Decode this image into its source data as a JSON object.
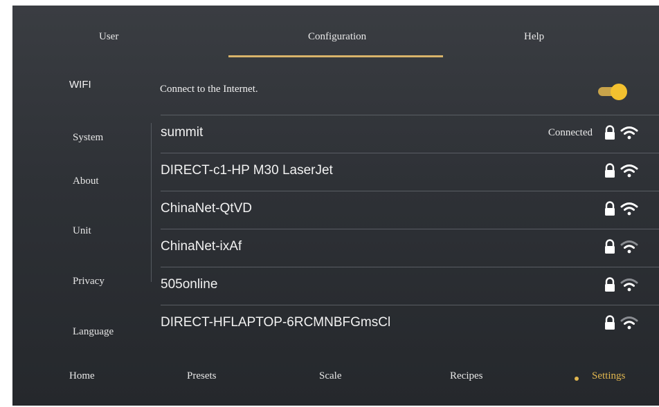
{
  "top_tabs": [
    {
      "label": "User"
    },
    {
      "label": "Configuration"
    },
    {
      "label": "Help"
    }
  ],
  "sidebar": {
    "section_title": "WIFI",
    "items": [
      {
        "label": "System"
      },
      {
        "label": "About"
      },
      {
        "label": "Unit"
      },
      {
        "label": "Privacy"
      },
      {
        "label": "Language"
      }
    ]
  },
  "wifi_panel": {
    "connect_label": "Connect to the Internet.",
    "toggle_on": true,
    "networks": [
      {
        "name": "summit",
        "status": "Connected",
        "secured": true,
        "signal": "strong"
      },
      {
        "name": "DIRECT-c1-HP M30 LaserJet",
        "status": "",
        "secured": true,
        "signal": "strong"
      },
      {
        "name": "ChinaNet-QtVD",
        "status": "",
        "secured": true,
        "signal": "strong"
      },
      {
        "name": "ChinaNet-ixAf",
        "status": "",
        "secured": true,
        "signal": "medium"
      },
      {
        "name": "505online",
        "status": "",
        "secured": true,
        "signal": "medium"
      },
      {
        "name": "DIRECT-HFLAPTOP-6RCMNBFGmsCl",
        "status": "",
        "secured": true,
        "signal": "medium"
      }
    ]
  },
  "bottom_nav": [
    {
      "label": "Home"
    },
    {
      "label": "Presets"
    },
    {
      "label": "Scale"
    },
    {
      "label": "Recipes"
    },
    {
      "label": "Settings"
    }
  ],
  "colors": {
    "accent": "#e0b64f",
    "toggle_knob": "#f3c12f",
    "background": "#2e3136"
  },
  "icons": {
    "lock": "lock-icon",
    "wifi": "wifi-signal-icon"
  }
}
